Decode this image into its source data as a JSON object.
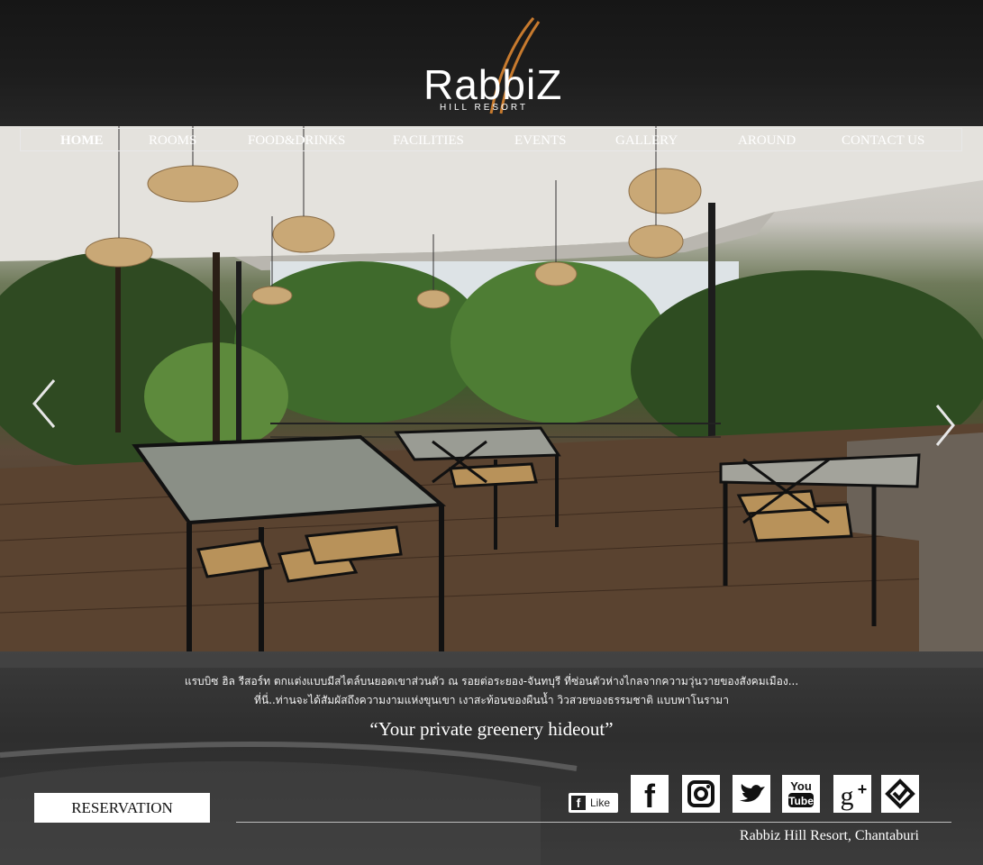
{
  "brand": {
    "name": "RabbiZ",
    "subtitle": "HILL RESORT",
    "accent_color": "#c77a2e"
  },
  "nav": {
    "items": [
      {
        "label": "HOME",
        "active": true
      },
      {
        "label": "ROOMS"
      },
      {
        "label": "FOOD&DRINKS"
      },
      {
        "label": "FACILITIES"
      },
      {
        "label": "EVENTS"
      },
      {
        "label": "GALLERY"
      },
      {
        "label": "AROUND"
      },
      {
        "label": "CONTACT US"
      }
    ]
  },
  "slider": {
    "prev_icon": "chevron-left-icon",
    "next_icon": "chevron-right-icon"
  },
  "intro": {
    "line1": "แรบบิซ ฮิล รีสอร์ท ตกแต่งแบบมีสไตล์บนยอดเขาส่วนตัว ณ รอยต่อระยอง-จันทบุรี ที่ซ่อนตัวห่างไกลจากความวุ่นวายของสังคมเมือง...",
    "line2": "ที่นี่..ท่านจะได้สัมผัสถึงความงามแห่งขุนเขา เงาสะท้อนของผืนน้ำ วิวสวยของธรรมชาติ แบบพาโนรามา",
    "tagline": "“Your private greenery hideout”"
  },
  "actions": {
    "reservation_label": "RESERVATION",
    "like_label": "Like"
  },
  "social": [
    {
      "name": "facebook-icon"
    },
    {
      "name": "instagram-icon"
    },
    {
      "name": "twitter-icon"
    },
    {
      "name": "youtube-icon"
    },
    {
      "name": "google-plus-icon"
    },
    {
      "name": "foursquare-icon"
    }
  ],
  "footer": {
    "text": "Rabbiz Hill Resort, Chantaburi"
  }
}
